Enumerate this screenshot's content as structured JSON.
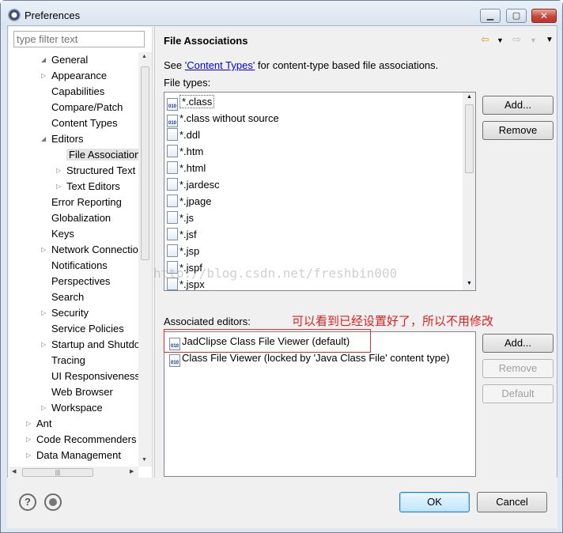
{
  "window": {
    "title": "Preferences",
    "min": "▁",
    "max": "▢",
    "close": "✕"
  },
  "filter": {
    "placeholder": "type filter text"
  },
  "tree": [
    {
      "label": "General",
      "arrow": "◢"
    },
    {
      "label": "Appearance",
      "arrow": "▷"
    },
    {
      "label": "Capabilities",
      "arrow": ""
    },
    {
      "label": "Compare/Patch",
      "arrow": ""
    },
    {
      "label": "Content Types",
      "arrow": ""
    },
    {
      "label": "Editors",
      "arrow": "◢"
    },
    {
      "label": "File Associations",
      "arrow": ""
    },
    {
      "label": "Structured Text",
      "arrow": "▷"
    },
    {
      "label": "Text Editors",
      "arrow": "▷"
    },
    {
      "label": "Error Reporting",
      "arrow": ""
    },
    {
      "label": "Globalization",
      "arrow": ""
    },
    {
      "label": "Keys",
      "arrow": ""
    },
    {
      "label": "Network Connections",
      "arrow": "▷"
    },
    {
      "label": "Notifications",
      "arrow": ""
    },
    {
      "label": "Perspectives",
      "arrow": ""
    },
    {
      "label": "Search",
      "arrow": ""
    },
    {
      "label": "Security",
      "arrow": "▷"
    },
    {
      "label": "Service Policies",
      "arrow": ""
    },
    {
      "label": "Startup and Shutdown",
      "arrow": "▷"
    },
    {
      "label": "Tracing",
      "arrow": ""
    },
    {
      "label": "UI Responsiveness",
      "arrow": ""
    },
    {
      "label": "Web Browser",
      "arrow": ""
    },
    {
      "label": "Workspace",
      "arrow": "▷"
    },
    {
      "label": "Ant",
      "arrow": "▷"
    },
    {
      "label": "Code Recommenders",
      "arrow": "▷"
    },
    {
      "label": "Data Management",
      "arrow": "▷"
    }
  ],
  "page": {
    "title": "File Associations",
    "see_prefix": "See ",
    "see_link": "'Content Types'",
    "see_suffix": " for content-type based file associations.",
    "file_types_label": "File types:",
    "assoc_label": "Associated editors:"
  },
  "file_types": [
    "*.class",
    "*.class without source",
    "*.ddl",
    "*.htm",
    "*.html",
    "*.jardesc",
    "*.jpage",
    "*.js",
    "*.jsf",
    "*.jsp",
    "*.jspf",
    "*.jspx"
  ],
  "editors": [
    "JadClipse Class File Viewer (default)",
    "Class File Viewer (locked by 'Java Class File' content type)"
  ],
  "buttons": {
    "add": "Add...",
    "remove": "Remove",
    "default": "Default",
    "ok": "OK",
    "cancel": "Cancel",
    "help": "?"
  },
  "annotation": "可以看到已经设置好了，所以不用修改",
  "watermark": "http://blog.csdn.net/freshbin000",
  "colors": {
    "annotation": "#e02020",
    "link": "#0000ee",
    "ok_border": "#3c7fb1"
  }
}
